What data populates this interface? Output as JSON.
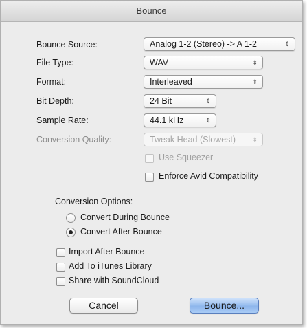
{
  "window": {
    "title": "Bounce"
  },
  "fields": {
    "bounce_source": {
      "label": "Bounce Source:",
      "value": "Analog 1-2 (Stereo) -> A 1-2"
    },
    "file_type": {
      "label": "File Type:",
      "value": "WAV"
    },
    "format": {
      "label": "Format:",
      "value": "Interleaved"
    },
    "bit_depth": {
      "label": "Bit Depth:",
      "value": "24 Bit"
    },
    "sample_rate": {
      "label": "Sample Rate:",
      "value": "44.1 kHz"
    },
    "conversion_quality": {
      "label": "Conversion Quality:",
      "value": "Tweak Head (Slowest)"
    }
  },
  "options": {
    "use_squeezer": {
      "label": "Use Squeezer",
      "checked": false,
      "enabled": false
    },
    "enforce_avid": {
      "label": "Enforce Avid Compatibility",
      "checked": false,
      "enabled": true
    }
  },
  "conversion_options": {
    "title": "Conversion Options:",
    "during": "Convert During Bounce",
    "after": "Convert After Bounce",
    "selected": "after"
  },
  "post": {
    "import_after": "Import After Bounce",
    "itunes": "Add To iTunes Library",
    "soundcloud": "Share with SoundCloud"
  },
  "buttons": {
    "cancel": "Cancel",
    "bounce": "Bounce..."
  },
  "icons": {
    "popup_arrows": "⇕"
  },
  "colors": {
    "default_button": "#8db6ec",
    "window_bg": "#ececec"
  }
}
